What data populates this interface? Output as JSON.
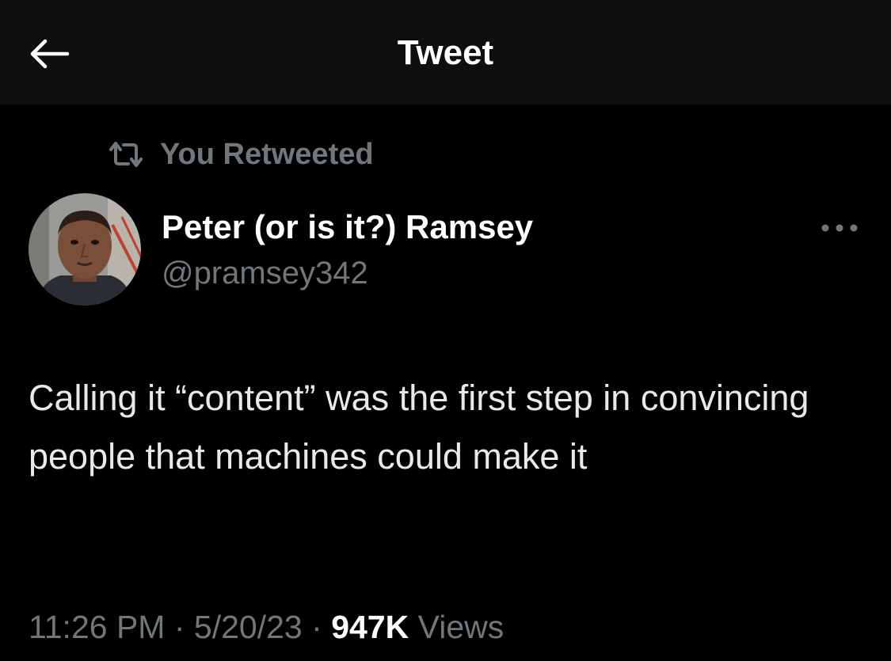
{
  "header": {
    "title": "Tweet",
    "back_icon": "arrow-left-icon"
  },
  "social_context": {
    "icon": "retweet-icon",
    "label": "You Retweeted"
  },
  "author": {
    "display_name": "Peter (or is it?) Ramsey",
    "handle": "@pramsey342",
    "avatar": "profile-photo"
  },
  "more_icon": "more-horizontal-icon",
  "tweet": {
    "text": "Calling it “content” was the first step in convincing people that machines could make it"
  },
  "meta": {
    "time": "11:26 PM",
    "separator": "·",
    "date": "5/20/23",
    "views_count": "947K",
    "views_label": "Views"
  },
  "colors": {
    "background": "#000000",
    "header_background": "#0f0f0f",
    "primary_text": "#e7e9ea",
    "secondary_text": "#71767b"
  }
}
